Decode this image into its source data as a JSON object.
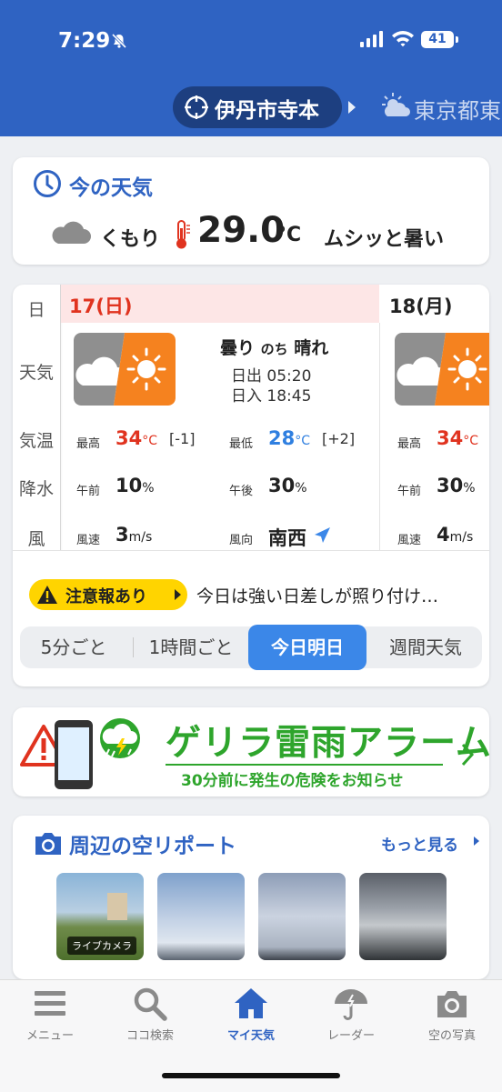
{
  "status_bar": {
    "time": "7:29",
    "battery": "41"
  },
  "location": {
    "current": "伊丹市寺本",
    "next": "東京都東"
  },
  "now": {
    "title": "今の天気",
    "condition": "くもり",
    "temperature": "29.0",
    "unit": "°C",
    "feeling": "ムシッと暑い"
  },
  "forecast": {
    "row_labels": {
      "day": "日",
      "weather": "天気",
      "temp": "気温",
      "precip": "降水",
      "wind": "風"
    },
    "today": {
      "label": "17(日)",
      "desc_main": "曇り",
      "desc_mid": "のち",
      "desc_after": "晴れ",
      "sunrise": "日出 05:20",
      "sunset": "日入 18:45",
      "high_label": "最高",
      "high": "34",
      "high_diff": "[-1]",
      "low_label": "最低",
      "low": "28",
      "low_diff": "[+2]",
      "am_label": "午前",
      "am_precip": "10",
      "pm_label": "午後",
      "pm_precip": "30",
      "wind_speed_label": "風速",
      "wind_speed": "3",
      "wind_dir_label": "風向",
      "wind_dir": "南西",
      "deg_unit": "°C",
      "pct_unit": "%",
      "speed_unit": "m/s"
    },
    "tomorrow": {
      "label": "18(月)",
      "high_label": "最高",
      "high": "34",
      "am_label": "午前",
      "am_precip": "30",
      "wind_speed_label": "風速",
      "wind_speed": "4"
    },
    "alert": {
      "badge": "注意報あり",
      "message": "今日は強い日差しが照り付け…"
    },
    "tabs": [
      "5分ごと",
      "1時間ごと",
      "今日明日",
      "週間天気"
    ],
    "active_tab": "今日明日"
  },
  "banner": {
    "title": "ゲリラ雷雨アラーム",
    "subtitle": "30分前に発生の危険をお知らせ"
  },
  "report": {
    "title": "周辺の空リポート",
    "more": "もっと見る",
    "live_label": "ライブカメラ"
  },
  "tabbar": [
    {
      "label": "メニュー",
      "icon": "menu-icon"
    },
    {
      "label": "ココ検索",
      "icon": "search-icon"
    },
    {
      "label": "マイ天気",
      "icon": "home-icon"
    },
    {
      "label": "レーダー",
      "icon": "umbrella-icon"
    },
    {
      "label": "空の写真",
      "icon": "camera-icon"
    }
  ],
  "colors": {
    "header": "#2f63c2",
    "accent": "#2f63c2",
    "hot": "#e0331f",
    "cold": "#2f7fe0",
    "alert": "#ffd400",
    "green": "#2ea52c",
    "active_tab": "#3b87e8"
  }
}
